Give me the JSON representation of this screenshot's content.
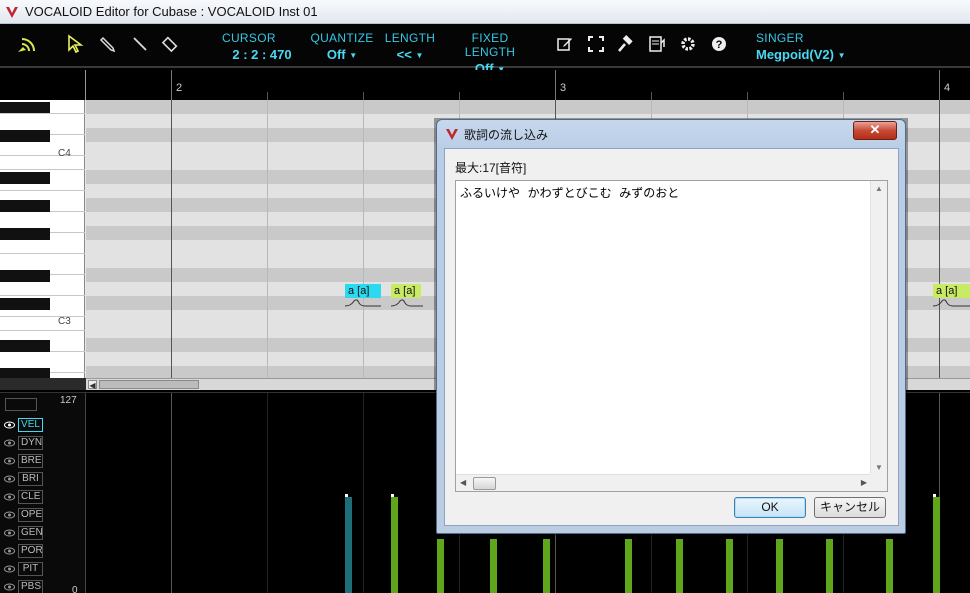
{
  "window": {
    "title": "VOCALOID Editor for Cubase : VOCALOID Inst 01"
  },
  "toolbar": {
    "tools": [
      "connect-icon",
      "arrow-tool-icon",
      "pencil-tool-icon",
      "line-tool-icon",
      "eraser-tool-icon"
    ],
    "cursor": {
      "label": "CURSOR",
      "value": "2 : 2 : 470"
    },
    "quantize": {
      "label": "QUANTIZE",
      "value": "Off"
    },
    "length": {
      "label": "LENGTH",
      "value": "<<"
    },
    "fixed_length": {
      "label": "FIXED LENGTH",
      "value": "Off"
    },
    "actions": [
      "edit-icon",
      "fullscreen-icon",
      "hammer-icon",
      "score-icon",
      "settings-icon",
      "help-icon"
    ],
    "singer": {
      "label": "SINGER",
      "value": "Megpoid(V2)"
    }
  },
  "ruler": {
    "bars": [
      "2",
      "3",
      "4"
    ]
  },
  "piano": {
    "labels": {
      "c4": "C4",
      "c3": "C3"
    }
  },
  "notes": [
    {
      "text": "a [a]",
      "color": "#2bdaf0"
    },
    {
      "text": "a [a]",
      "color": "#c8ea64"
    },
    {
      "text": "a [a]",
      "color": "#c8ea64"
    }
  ],
  "control_track": {
    "max": "127",
    "min": "0",
    "items": [
      "VEL",
      "DYN",
      "BRE",
      "BRI",
      "CLE",
      "OPE",
      "GEN",
      "POR",
      "PIT",
      "PBS"
    ],
    "active": "VEL"
  },
  "dialog": {
    "title": "歌詞の流し込み",
    "close": "✕",
    "label": "最大:17[音符]",
    "text": "ふるいけや  かわずとびこむ  みずのおと",
    "ok": "OK",
    "cancel": "キャンセル"
  },
  "colors": {
    "accent": "#45d8f0",
    "note_cyan": "#2bdaf0",
    "note_lime": "#c8ea64",
    "vel_bar": "#5fa61a"
  }
}
